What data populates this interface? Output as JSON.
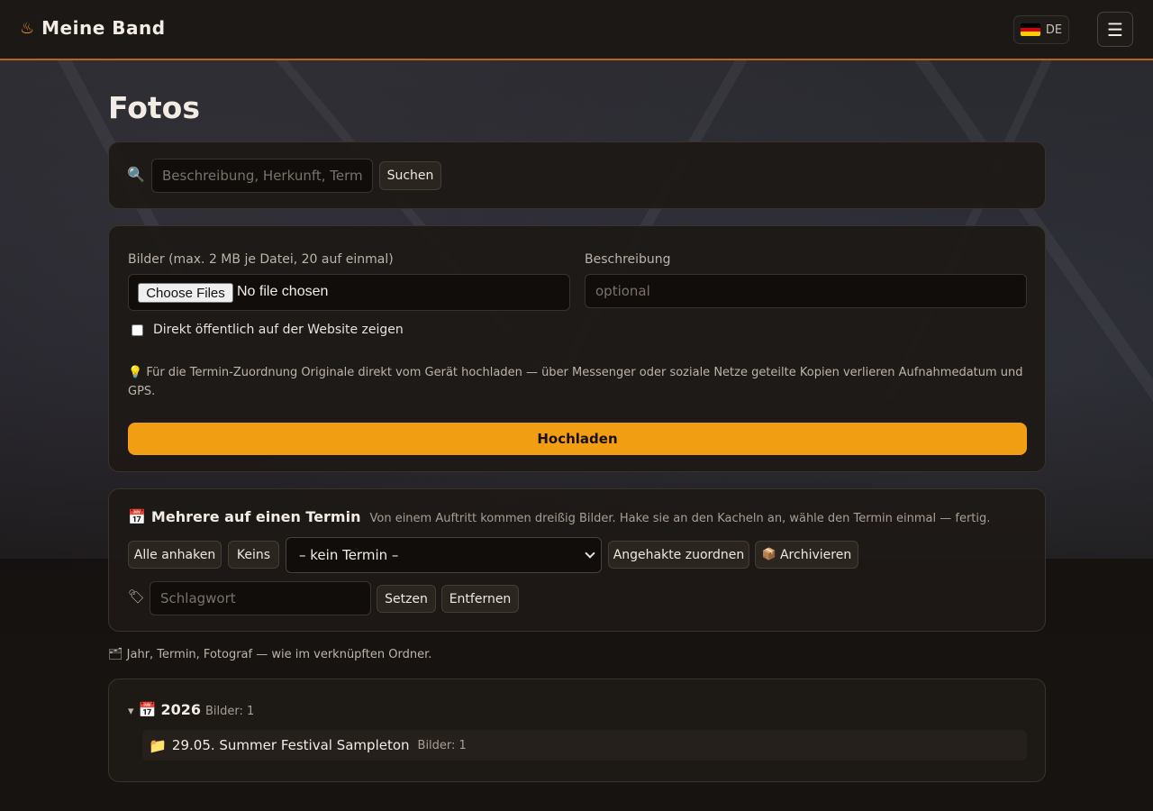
{
  "header": {
    "brand_icon": "♨",
    "brand_name": "Meine Band",
    "lang_code": "DE",
    "menu_icon": "☰"
  },
  "page": {
    "title": "Fotos"
  },
  "search": {
    "icon": "🔍",
    "placeholder": "Beschreibung, Herkunft, Termin",
    "button_label": "Suchen"
  },
  "upload": {
    "images_label": "Bilder (max. 2 MB je Datei, 20 auf einmal)",
    "choose_files_label": "Choose Files",
    "no_file_text": "No file chosen",
    "description_label": "Beschreibung",
    "description_placeholder": "optional",
    "public_checkbox_label": "Direkt öffentlich auf der Website zeigen",
    "public_checked": false,
    "hint_icon": "💡",
    "hint_text": "Für die Termin-Zuordnung Originale direkt vom Gerät hochladen — über Messenger oder soziale Netze geteilte Kopien verlieren Aufnahmedatum und GPS.",
    "submit_label": "Hochladen"
  },
  "bulk": {
    "icon": "📅",
    "title": "Mehrere auf einen Termin",
    "subtitle": "Von einem Auftritt kommen dreißig Bilder. Hake sie an den Kacheln an, wähle den Termin einmal — fertig.",
    "select_all_label": "Alle anhaken",
    "select_none_label": "Keins",
    "termin_selected": "– kein Termin –",
    "assign_label": "Angehakte zuordnen",
    "archive_icon": "📦",
    "archive_label": "Archivieren",
    "tag_icon": "🏷",
    "tag_placeholder": "Schlagwort",
    "set_label": "Setzen",
    "remove_label": "Entfernen"
  },
  "folders": {
    "hint_icon": "🗂",
    "hint_text": "Jahr, Termin, Fotograf — wie im verknüpften Ordner.",
    "years": [
      {
        "toggle": "▾",
        "icon": "📅",
        "year": "2026",
        "count_label": "Bilder: 1",
        "events": [
          {
            "icon": "📁",
            "name": "29.05. Summer Festival Sampleton",
            "count_label": "Bilder: 1"
          }
        ]
      }
    ]
  },
  "colors": {
    "accent": "#f29e12",
    "header_border": "#b7651c",
    "card_bg": "#1e1916",
    "page_bg": "#151210"
  }
}
